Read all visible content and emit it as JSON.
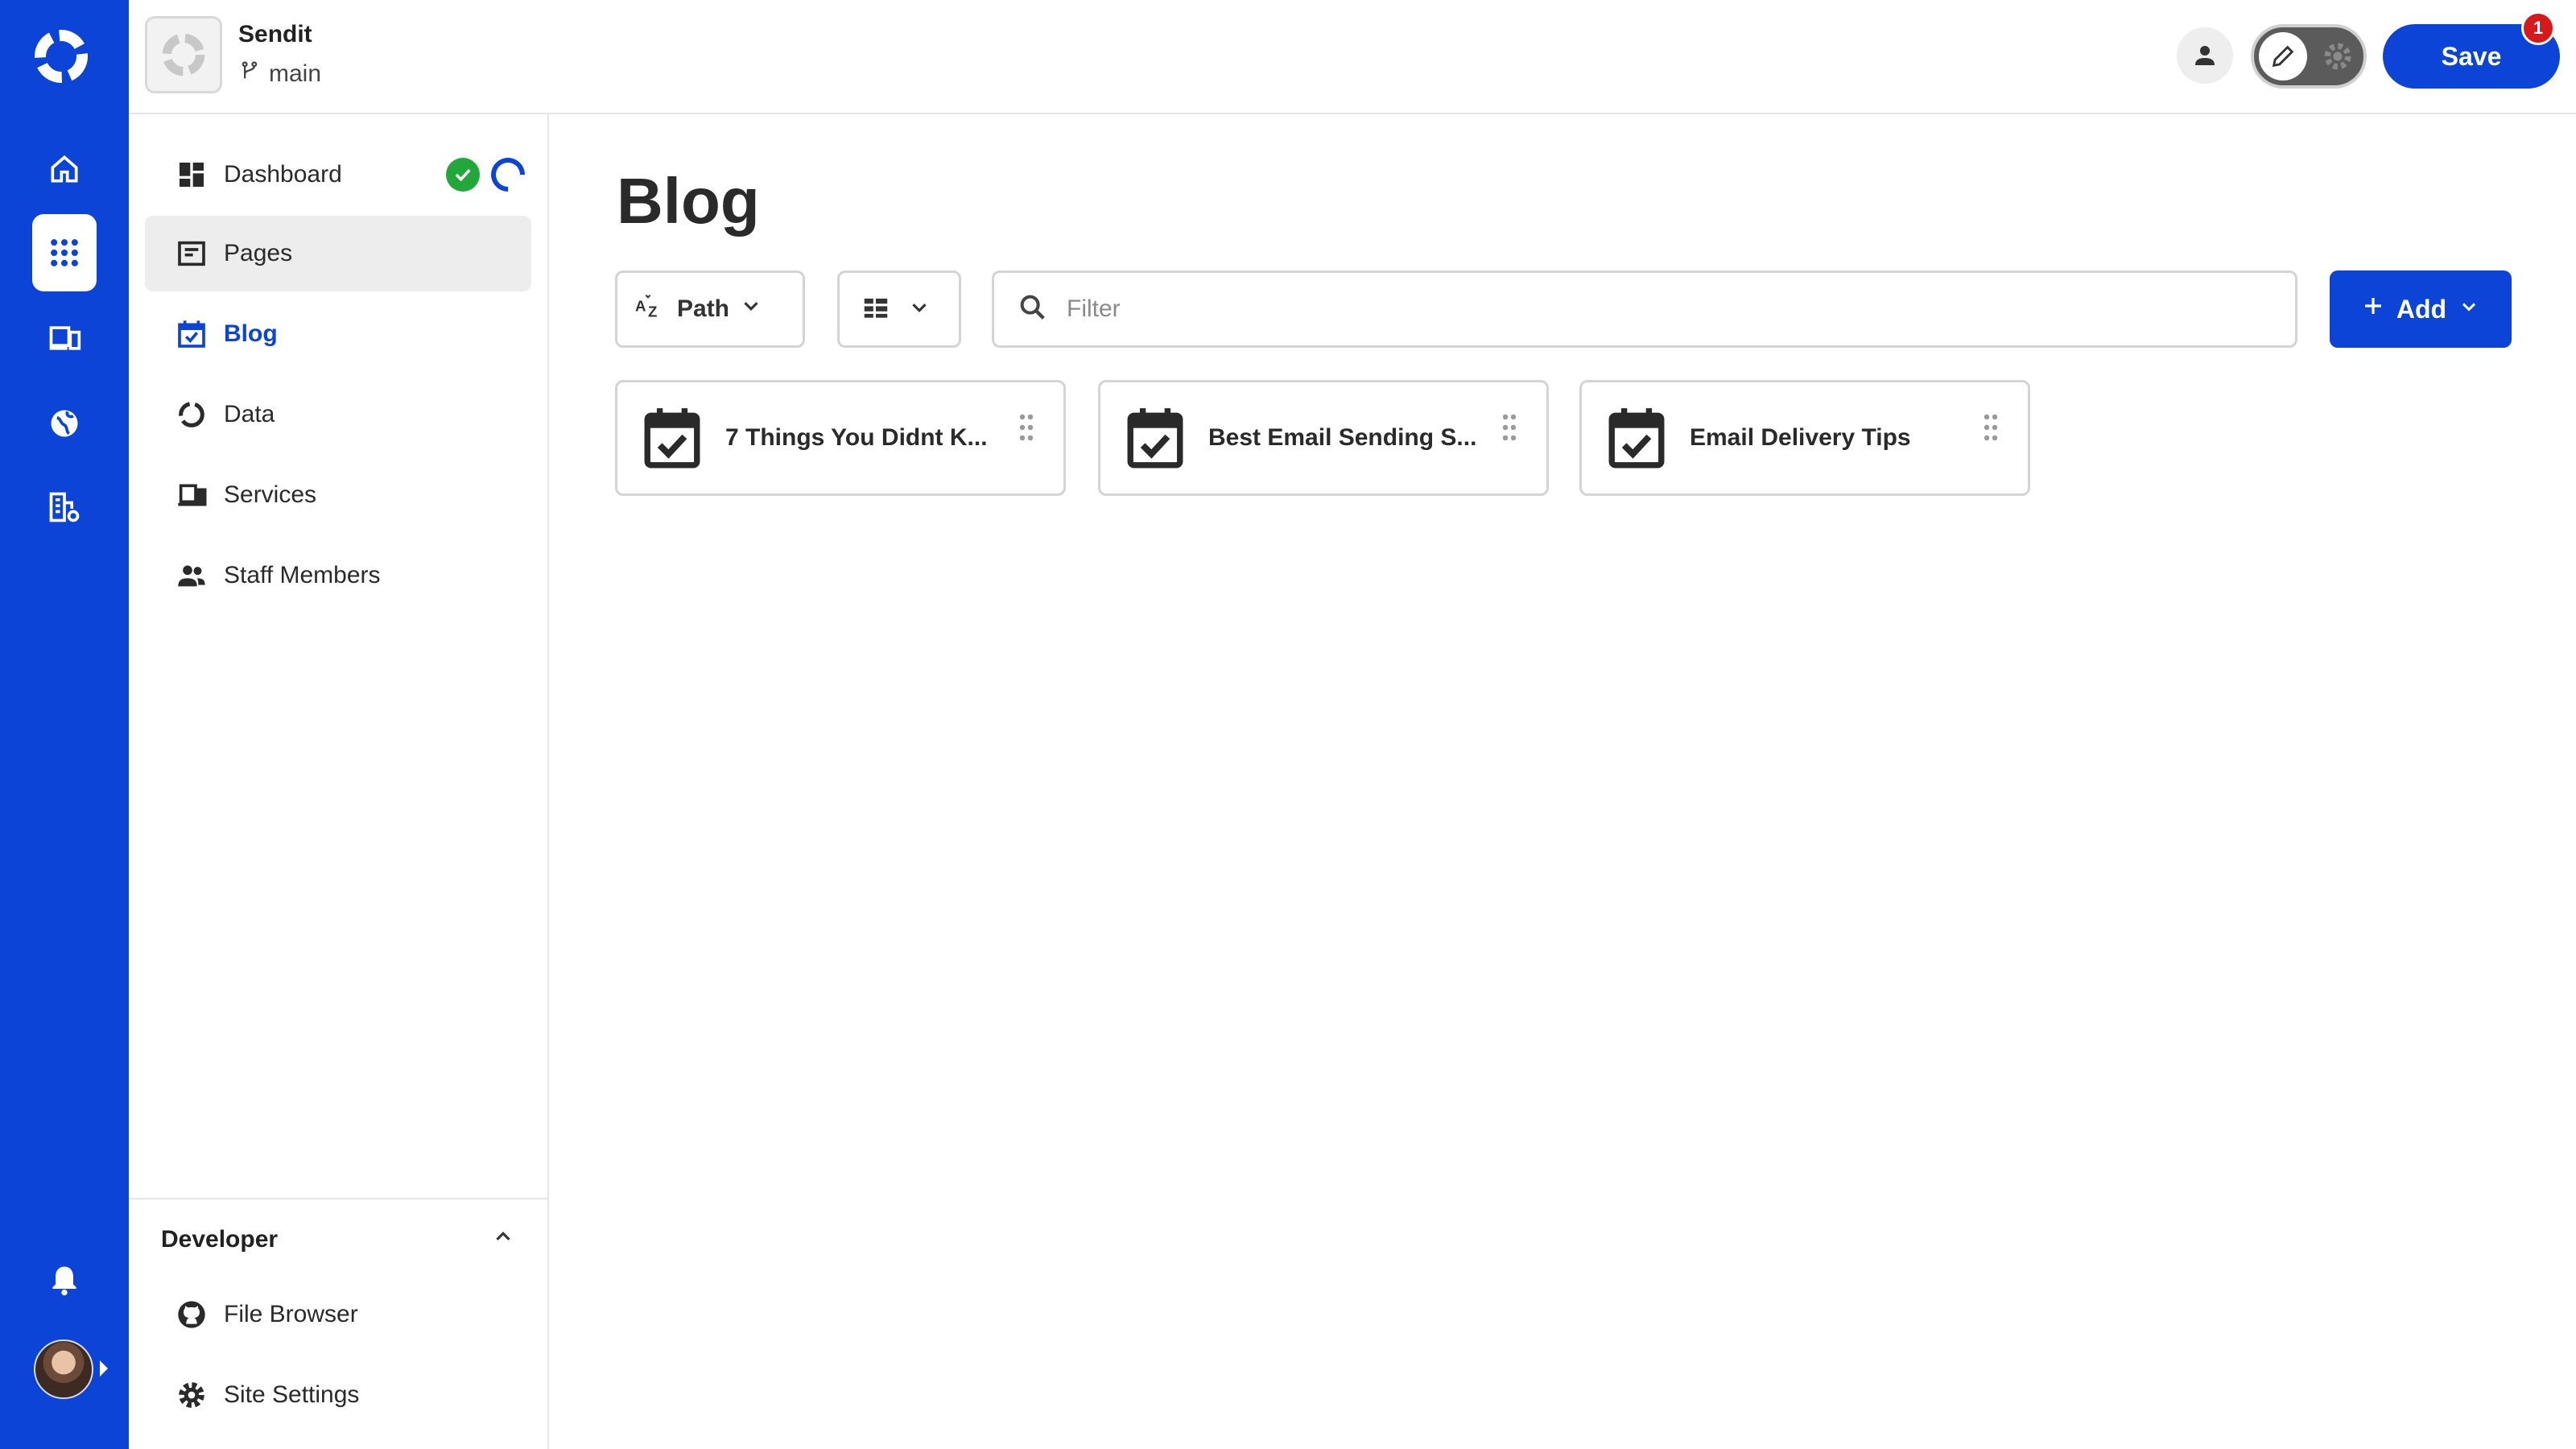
{
  "app": {
    "site_name": "Sendit",
    "branch": "main",
    "save_label": "Save",
    "save_badge": "1",
    "accent": "#0b44d6"
  },
  "sidebar": {
    "items": [
      {
        "label": "Dashboard",
        "icon": "dashboard-icon"
      },
      {
        "label": "Pages",
        "icon": "pages-icon"
      },
      {
        "label": "Blog",
        "icon": "calendar-check-icon"
      },
      {
        "label": "Data",
        "icon": "data-ring-icon"
      },
      {
        "label": "Services",
        "icon": "devices-icon"
      },
      {
        "label": "Staff Members",
        "icon": "people-icon"
      }
    ],
    "developer": {
      "heading": "Developer",
      "items": [
        {
          "label": "File Browser",
          "icon": "github-icon"
        },
        {
          "label": "Site Settings",
          "icon": "gear-icon"
        }
      ]
    }
  },
  "main": {
    "title": "Blog",
    "sort_label": "Path",
    "filter_placeholder": "Filter",
    "add_label": "Add",
    "cards": [
      {
        "title": "7 Things You Didnt K..."
      },
      {
        "title": "Best Email Sending S..."
      },
      {
        "title": "Email Delivery Tips"
      }
    ]
  }
}
